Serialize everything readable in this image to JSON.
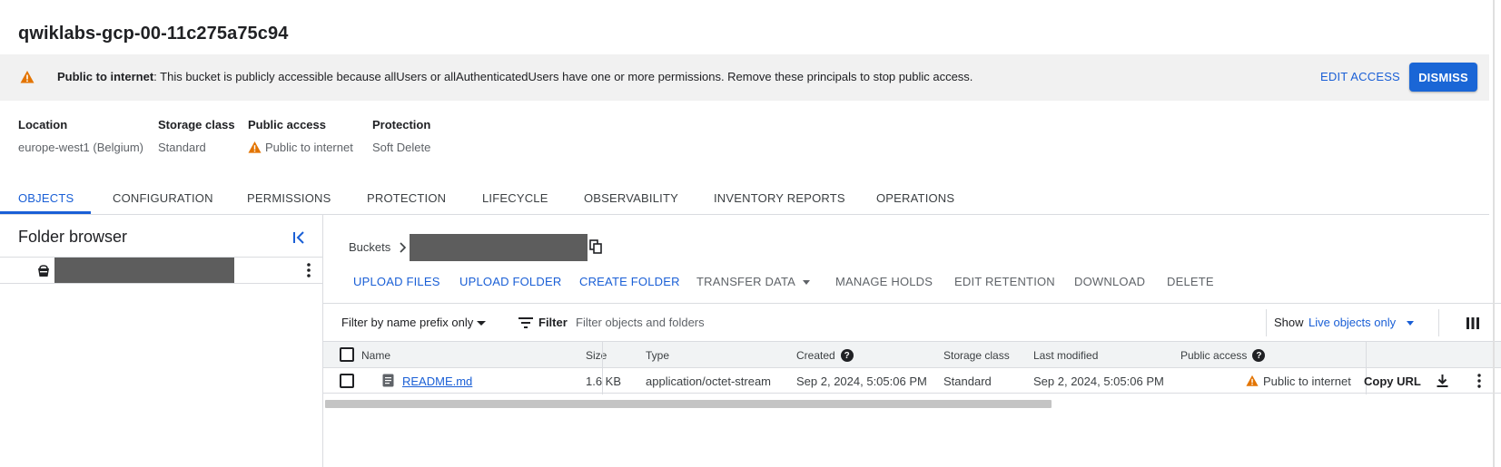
{
  "header": {
    "title": "qwiklabs-gcp-00-11c275a75c94"
  },
  "banner": {
    "bold": "Public to internet",
    "message": ": This bucket is publicly accessible because allUsers or allAuthenticatedUsers have one or more permissions. Remove these principals to stop public access.",
    "edit_access": "EDIT ACCESS",
    "dismiss": "DISMISS",
    "warning_color": "#e37400"
  },
  "meta": [
    {
      "label": "Location",
      "value": "europe-west1 (Belgium)"
    },
    {
      "label": "Storage class",
      "value": "Standard"
    },
    {
      "label": "Public access",
      "value": "Public to internet",
      "icon": "warning-icon"
    },
    {
      "label": "Protection",
      "value": "Soft Delete"
    }
  ],
  "tabs": [
    "OBJECTS",
    "CONFIGURATION",
    "PERMISSIONS",
    "PROTECTION",
    "LIFECYCLE",
    "OBSERVABILITY",
    "INVENTORY REPORTS",
    "OPERATIONS"
  ],
  "active_tab": "OBJECTS",
  "folder_browser": {
    "title": "Folder browser"
  },
  "breadcrumb": {
    "root": "Buckets"
  },
  "actions": {
    "upload_files": "UPLOAD FILES",
    "upload_folder": "UPLOAD FOLDER",
    "create_folder": "CREATE FOLDER",
    "transfer_data": "TRANSFER DATA",
    "manage_holds": "MANAGE HOLDS",
    "edit_retention": "EDIT RETENTION",
    "download": "DOWNLOAD",
    "delete": "DELETE"
  },
  "filter": {
    "prefix": "Filter by name prefix only",
    "label": "Filter",
    "placeholder": "Filter objects and folders",
    "show_label": "Show",
    "show_value": "Live objects only"
  },
  "table": {
    "columns": {
      "name": "Name",
      "size": "Size",
      "type": "Type",
      "created": "Created",
      "storage_class": "Storage class",
      "last_modified": "Last modified",
      "public_access": "Public access"
    },
    "rows": [
      {
        "name": "README.md",
        "size": "1.6 KB",
        "type": "application/octet-stream",
        "created": "Sep 2, 2024, 5:05:06 PM",
        "storage_class": "Standard",
        "last_modified": "Sep 2, 2024, 5:05:06 PM",
        "public_access": "Public to internet",
        "copy_url": "Copy URL"
      }
    ]
  },
  "colors": {
    "accent": "#1a5fd6",
    "primary_button": "#1a66d6",
    "redacted": "#5d5d5d"
  }
}
